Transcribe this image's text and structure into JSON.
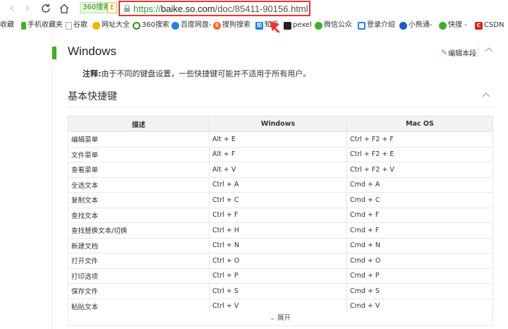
{
  "toolbar": {
    "engine_label": "360搜索",
    "engine_icon_glyph": "E",
    "url_scheme": "https://",
    "url_host": "baike.so.com",
    "url_path": "/doc/85411-90156.html"
  },
  "bookmarks": [
    {
      "label": "收藏",
      "color": "#f0a020",
      "glyph": ""
    },
    {
      "label": "手机收藏夹",
      "color": "#3eaf2c",
      "glyph": ""
    },
    {
      "label": "谷歌",
      "color": "#888888",
      "glyph": ""
    },
    {
      "label": "网址大全",
      "color": "#e8b800",
      "glyph": ""
    },
    {
      "label": "360搜索",
      "color": "#2e8d1b",
      "glyph": ""
    },
    {
      "label": "百度网盘-",
      "color": "#2a7fe0",
      "glyph": ""
    },
    {
      "label": "搜狗搜索",
      "color": "#f06a20",
      "glyph": "S"
    },
    {
      "label": "知乎",
      "color": "#1a7fe0",
      "glyph": "知"
    },
    {
      "label": "pexel",
      "color": "#222222",
      "glyph": ""
    },
    {
      "label": "微信公众",
      "color": "#3eaf2c",
      "glyph": ""
    },
    {
      "label": "登录介绍",
      "color": "#2a7fe0",
      "glyph": ""
    },
    {
      "label": "小熊通-",
      "color": "#1a5fc0",
      "glyph": ""
    },
    {
      "label": "快搜 -",
      "color": "#3eaf2c",
      "glyph": ""
    },
    {
      "label": "CSDN",
      "color": "#d9261c",
      "glyph": "C"
    }
  ],
  "content": {
    "title": "Windows",
    "edit_label": "编辑本段",
    "note_label": "注释:",
    "note_text": "由于不同的键盘设置，一些快捷键可能并不适用于所有用户。",
    "subsection_title": "基本快捷键",
    "table": {
      "headers": [
        "描述",
        "Windows",
        "Mac OS"
      ],
      "rows": [
        [
          "编辑菜单",
          "Alt + E",
          "Ctrl + F2 + F"
        ],
        [
          "文件菜单",
          "Alt + F",
          "Ctrl + F2 + E"
        ],
        [
          "查看菜单",
          "Alt + V",
          "Ctrl + F2 + V"
        ],
        [
          "全选文本",
          "Ctrl + A",
          "Cmd + A"
        ],
        [
          "复制文本",
          "Ctrl + C",
          "Cmd + C"
        ],
        [
          "查找文本",
          "Ctrl + F",
          "Cmd + F"
        ],
        [
          "查找替换文本/切换",
          "Ctrl + H",
          "Cmd + F"
        ],
        [
          "新建文档",
          "Ctrl + N",
          "Cmd + N"
        ],
        [
          "打开文件",
          "Ctrl + O",
          "Cmd + O"
        ],
        [
          "打印选项",
          "Ctrl + P",
          "Cmd + P"
        ],
        [
          "保存文件",
          "Ctrl + S",
          "Cmd + S"
        ],
        [
          "粘贴文本",
          "Ctrl + V",
          "Cmd + V"
        ]
      ]
    },
    "expand_label": "展开"
  },
  "colors": {
    "accent_green": "#3eaf2c",
    "annotation_red": "#e33333"
  }
}
